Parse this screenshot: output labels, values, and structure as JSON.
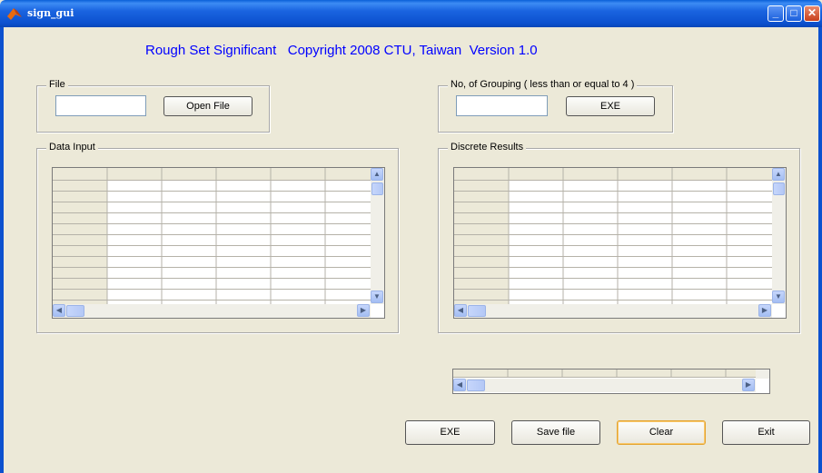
{
  "window": {
    "title": "sign_gui"
  },
  "header": {
    "title": "Rough Set Significant   Copyright 2008 CTU, Taiwan  Version 1.0"
  },
  "file_group": {
    "label": "File",
    "input_value": "",
    "open_button": "Open File"
  },
  "grouping_group": {
    "label": "No, of Grouping ( less than or equal to 4 )",
    "input_value": "",
    "exe_button": "EXE"
  },
  "data_input": {
    "label": "Data Input"
  },
  "discrete_results": {
    "label": "Discrete Results"
  },
  "bottom_buttons": {
    "exe": "EXE",
    "save": "Save file",
    "clear": "Clear",
    "exit": "Exit"
  },
  "icons": {
    "vscroll_up": "▲",
    "vscroll_down": "▼",
    "hscroll_left": "◀",
    "hscroll_right": "▶",
    "minimize": "_",
    "maximize": "□",
    "close": "✕"
  }
}
